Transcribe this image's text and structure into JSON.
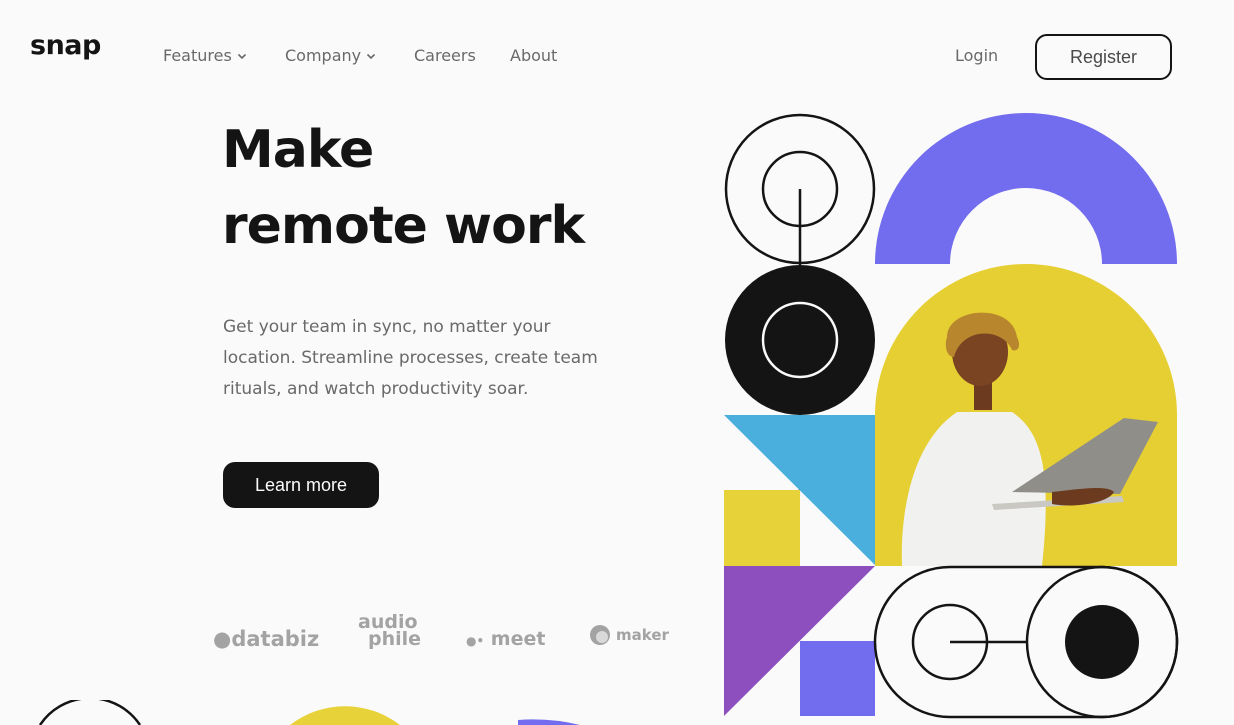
{
  "brand": {
    "logo": "snap"
  },
  "nav": {
    "items": [
      {
        "label": "Features",
        "has_dropdown": true
      },
      {
        "label": "Company",
        "has_dropdown": true
      },
      {
        "label": "Careers",
        "has_dropdown": false
      },
      {
        "label": "About",
        "has_dropdown": false
      }
    ],
    "login_label": "Login",
    "register_label": "Register"
  },
  "hero": {
    "title_line1": "Make",
    "title_line2": "remote work",
    "description": "Get your team in sync, no matter your location. Streamline processes, create team rituals, and watch productivity soar.",
    "cta_label": "Learn more"
  },
  "clients": {
    "databiz": "databiz",
    "audiophile_line1": "audio",
    "audiophile_line2": "phile",
    "meet": "meet",
    "maker": "maker"
  },
  "colors": {
    "text_dark": "#141414",
    "text_gray": "#696969",
    "logo_gray": "#a3a3a3",
    "purple": "#726cee",
    "yellow": "#e8d23a",
    "blue": "#4aafdc",
    "violet": "#8c4fbd",
    "background": "#fafafa"
  }
}
